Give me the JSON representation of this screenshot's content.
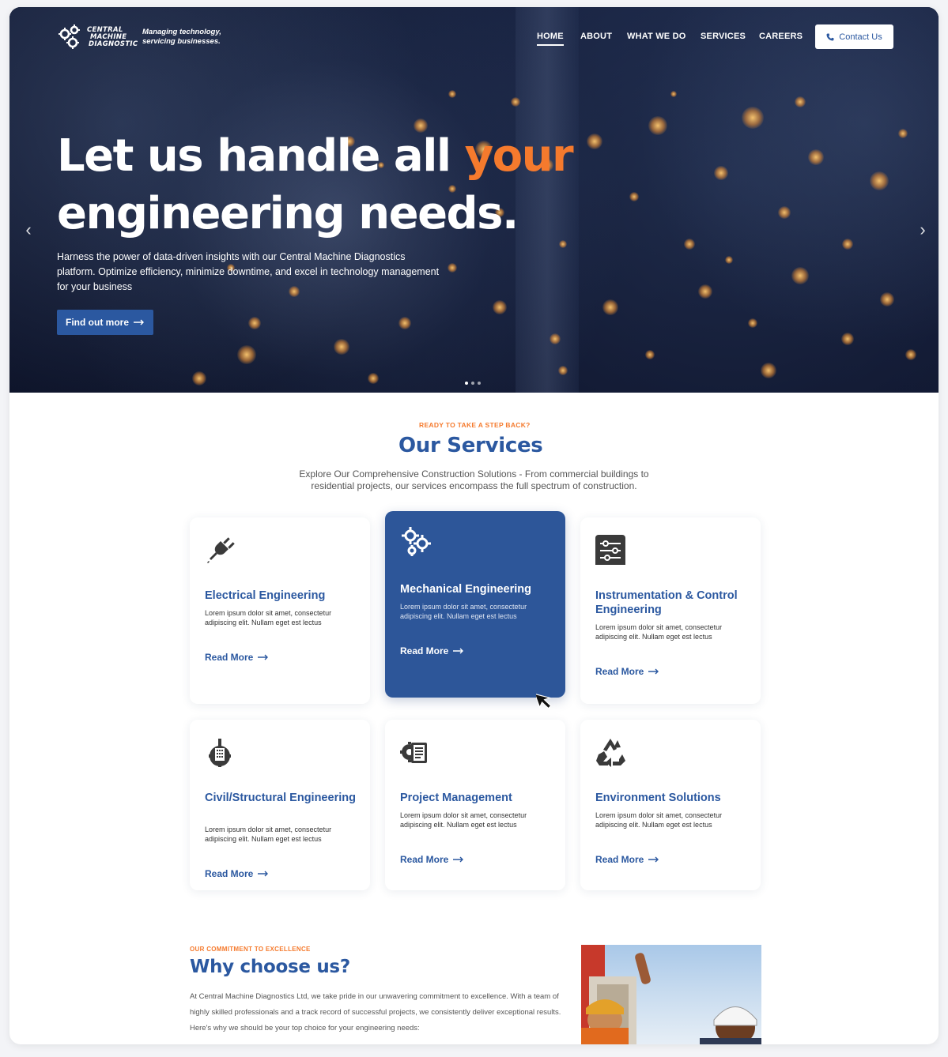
{
  "logo": {
    "line1": "CENTRAL",
    "line2": "MACHINE",
    "line3": "DIAGNOSTIC"
  },
  "tagline": "Managing technology, servicing businesses.",
  "nav": {
    "home": "HOME",
    "about": "ABOUT",
    "what_we_do": "WHAT WE DO",
    "services": "SERVICES",
    "careers": "CAREERS",
    "contact": "Contact Us"
  },
  "hero": {
    "title_part1": "Let us handle all ",
    "title_accent": "your",
    "title_line2": "engineering needs.",
    "description": "Harness the power of data-driven insights with our Central Machine Diagnostics platform. Optimize efficiency, minimize downtime, and excel in technology management for your business",
    "cta": "Find out more",
    "prev_arrow": "‹",
    "next_arrow": "›",
    "slide_count": 3,
    "active_slide": 1
  },
  "services": {
    "eyebrow": "READY TO TAKE A STEP BACK?",
    "title": "Our Services",
    "description": "Explore Our Comprehensive Construction Solutions - From commercial buildings to residential projects, our services encompass the full spectrum of construction.",
    "cards": [
      {
        "title": "Electrical Engineering",
        "text": "Lorem ipsum dolor sit amet, consectetur adipiscing elit. Nullam eget est lectus",
        "more": "Read More",
        "icon": "plug-icon"
      },
      {
        "title": "Mechanical Engineering",
        "text": "Lorem ipsum dolor sit amet, consectetur adipiscing elit. Nullam eget est lectus",
        "more": "Read More",
        "icon": "gears-icon"
      },
      {
        "title": "Instrumentation & Control Engineering",
        "text": "Lorem ipsum dolor sit amet, consectetur adipiscing elit. Nullam eget est lectus",
        "more": "Read More",
        "icon": "sliders-icon"
      },
      {
        "title": "Civil/Structural Engineering",
        "text": "Lorem ipsum dolor sit amet, consectetur adipiscing elit. Nullam eget est lectus",
        "more": "Read More",
        "icon": "building-gear-icon"
      },
      {
        "title": "Project Management",
        "text": "Lorem ipsum dolor sit amet, consectetur adipiscing elit. Nullam eget est lectus",
        "more": "Read More",
        "icon": "document-gear-icon"
      },
      {
        "title": "Environment Solutions",
        "text": "Lorem ipsum dolor sit amet, consectetur adipiscing elit. Nullam eget est lectus",
        "more": "Read More",
        "icon": "recycle-icon"
      }
    ]
  },
  "why": {
    "eyebrow": "OUR COMMITMENT TO EXCELLENCE",
    "title": "Why choose us?",
    "description": "At Central Machine Diagnostics Ltd, we take pride in our unwavering commitment to excellence. With a team of highly skilled professionals and a track record of successful projects, we consistently deliver exceptional results. Here's why we should be your top choice for your engineering needs:"
  },
  "colors": {
    "brand_blue": "#2b58a0",
    "accent_orange": "#f57a2d",
    "hero_dark": "#141c33"
  }
}
